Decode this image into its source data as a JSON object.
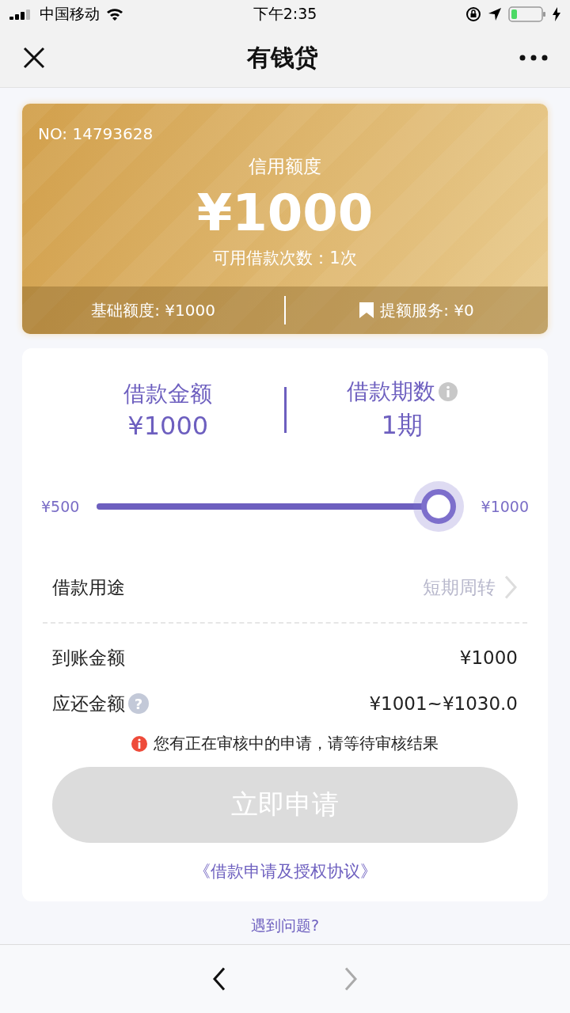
{
  "status_bar": {
    "carrier": "中国移动",
    "time": "下午2:35"
  },
  "nav": {
    "title": "有钱贷"
  },
  "credit_card": {
    "number": "NO: 14793628",
    "label": "信用额度",
    "amount": "¥1000",
    "uses": "可用借款次数：1次",
    "base": "基础额度: ¥1000",
    "boost": "提额服务: ¥0"
  },
  "loan": {
    "amount_label": "借款金额",
    "amount": "¥1000",
    "term_label": "借款期数",
    "term": "1期",
    "slider": {
      "min": "¥500",
      "max": "¥1000",
      "level": 1.0
    },
    "purpose": {
      "label": "借款用途",
      "value": "短期周转"
    },
    "rows": [
      {
        "label": "到账金额",
        "value": "¥1000"
      },
      {
        "label": "应还金额",
        "value": "¥1001~¥1030.0",
        "help": "?"
      }
    ],
    "notice": "您有正在审核中的申请，请等待审核结果",
    "apply": {
      "label": "立即申请",
      "disabled": true
    },
    "agreement": "《借款申请及授权协议》"
  },
  "help_link": "遇到问题?",
  "toolbar": {
    "back_disabled": false,
    "forward_disabled": true
  }
}
